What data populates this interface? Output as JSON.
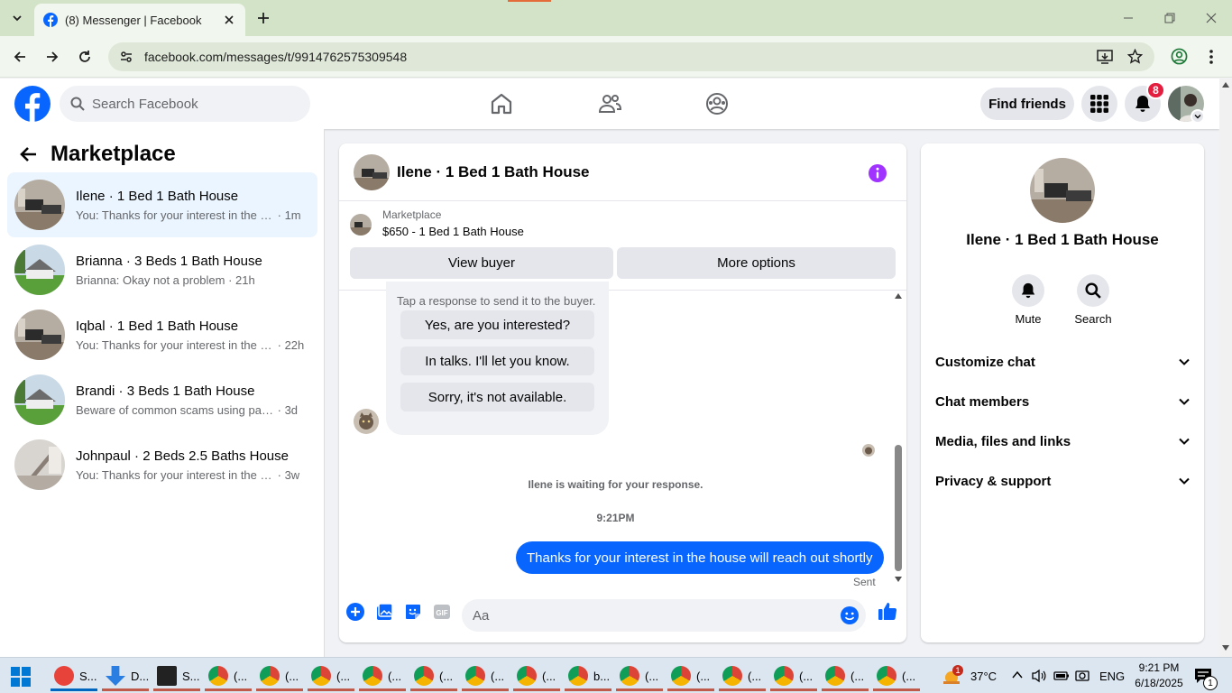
{
  "browser": {
    "tab_title": "(8) Messenger | Facebook",
    "url": "facebook.com/messages/t/9914762575309548"
  },
  "fb": {
    "search_placeholder": "Search Facebook",
    "find_friends": "Find friends",
    "notif_count": "8"
  },
  "left": {
    "title": "Marketplace",
    "conversations": [
      {
        "name": "Ilene · 1 Bed 1 Bath House",
        "preview": "You: Thanks for your interest in the h...",
        "time": "· 1m"
      },
      {
        "name": "Brianna · 3 Beds 1 Bath House",
        "preview": "Brianna: Okay not a problem",
        "time": "· 21h"
      },
      {
        "name": "Iqbal · 1 Bed 1 Bath House",
        "preview": "You: Thanks for your interest in the h...",
        "time": "· 22h"
      },
      {
        "name": "Brandi · 3 Beds 1 Bath House",
        "preview": "Beware of common scams using pay...",
        "time": "· 3d"
      },
      {
        "name": "Johnpaul · 2 Beds 2.5 Baths House",
        "preview": "You: Thanks for your interest in the h...",
        "time": "· 3w"
      }
    ]
  },
  "chat": {
    "title": "Ilene · 1 Bed 1 Bath House",
    "marketplace_label": "Marketplace",
    "listing": "$650 - 1 Bed 1 Bath House",
    "view_buyer": "View buyer",
    "more_options": "More options",
    "quick_hint": "Tap a response to send it to the buyer.",
    "quick_replies": [
      "Yes, are you interested?",
      "In talks. I'll let you know.",
      "Sorry, it's not available."
    ],
    "waiting": "Ilene is waiting for your response.",
    "time": "9:21PM",
    "message": "Thanks for your interest in the house will reach out shortly",
    "status": "Sent",
    "input_placeholder": "Aa"
  },
  "right": {
    "name": "Ilene · 1 Bed 1 Bath House",
    "mute": "Mute",
    "search": "Search",
    "sections": [
      "Customize chat",
      "Chat members",
      "Media, files and links",
      "Privacy & support"
    ]
  },
  "taskbar": {
    "apps": [
      {
        "label": "S...",
        "color": "#e8433a"
      },
      {
        "label": "D...",
        "color": "#2a7de1"
      },
      {
        "label": "S...",
        "color": "#222222"
      },
      {
        "label": "(...",
        "color": "#db4437"
      },
      {
        "label": "(...",
        "color": "#db4437"
      },
      {
        "label": "(...",
        "color": "#db4437"
      },
      {
        "label": "(...",
        "color": "#db4437"
      },
      {
        "label": "(...",
        "color": "#db4437"
      },
      {
        "label": "(...",
        "color": "#db4437"
      },
      {
        "label": "(...",
        "color": "#db4437"
      },
      {
        "label": "b...",
        "color": "#db4437"
      },
      {
        "label": "(...",
        "color": "#db4437"
      },
      {
        "label": "(...",
        "color": "#db4437"
      },
      {
        "label": "(...",
        "color": "#db4437"
      },
      {
        "label": "(...",
        "color": "#db4437"
      },
      {
        "label": "(...",
        "color": "#db4437"
      },
      {
        "label": "(...",
        "color": "#db4437"
      }
    ],
    "weather_badge": "1",
    "temperature": "37°C",
    "language": "ENG",
    "time": "9:21 PM",
    "date": "6/18/2025",
    "notif_badge": "1"
  },
  "colors": {
    "accent": "#0866ff",
    "fb_blue": "#0866ff",
    "badge_red": "#e41e3f",
    "info_purple": "#a033ff"
  }
}
